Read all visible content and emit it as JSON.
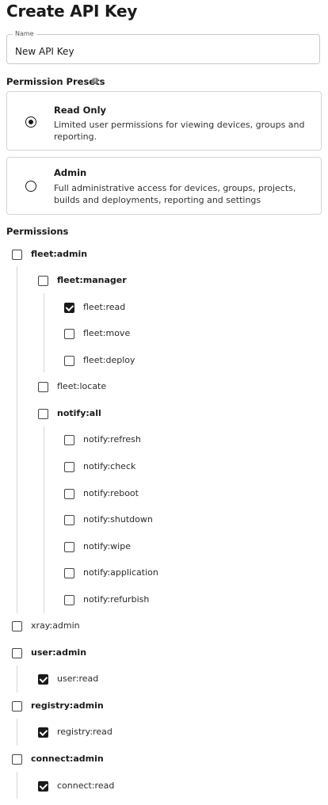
{
  "page": {
    "title": "Create API Key"
  },
  "name_field": {
    "label": "Name",
    "value": "New API Key"
  },
  "presets": {
    "heading": "Permission Presets",
    "info_icon": "info-icon",
    "items": [
      {
        "title": "Read Only",
        "description": "Limited user permissions for viewing devices, groups and reporting.",
        "selected": true
      },
      {
        "title": "Admin",
        "description": "Full administrative access for devices, groups, projects, builds and deployments, reporting and settings",
        "selected": false
      }
    ]
  },
  "permissions": {
    "heading": "Permissions",
    "items": [
      {
        "label": "fleet:admin",
        "checked": false,
        "level": 0,
        "bold": true
      },
      {
        "label": "fleet:manager",
        "checked": false,
        "level": 1,
        "bold": true
      },
      {
        "label": "fleet:read",
        "checked": true,
        "level": 2,
        "bold": false
      },
      {
        "label": "fleet:move",
        "checked": false,
        "level": 2,
        "bold": false
      },
      {
        "label": "fleet:deploy",
        "checked": false,
        "level": 2,
        "bold": false
      },
      {
        "label": "fleet:locate",
        "checked": false,
        "level": 1,
        "bold": false
      },
      {
        "label": "notify:all",
        "checked": false,
        "level": 1,
        "bold": true
      },
      {
        "label": "notify:refresh",
        "checked": false,
        "level": 2,
        "bold": false
      },
      {
        "label": "notify:check",
        "checked": false,
        "level": 2,
        "bold": false
      },
      {
        "label": "notify:reboot",
        "checked": false,
        "level": 2,
        "bold": false
      },
      {
        "label": "notify:shutdown",
        "checked": false,
        "level": 2,
        "bold": false
      },
      {
        "label": "notify:wipe",
        "checked": false,
        "level": 2,
        "bold": false
      },
      {
        "label": "notify:application",
        "checked": false,
        "level": 2,
        "bold": false
      },
      {
        "label": "notify:refurbish",
        "checked": false,
        "level": 2,
        "bold": false
      },
      {
        "label": "xray:admin",
        "checked": false,
        "level": 0,
        "bold": false
      },
      {
        "label": "user:admin",
        "checked": false,
        "level": 0,
        "bold": true
      },
      {
        "label": "user:read",
        "checked": true,
        "level": 1,
        "bold": false
      },
      {
        "label": "registry:admin",
        "checked": false,
        "level": 0,
        "bold": true
      },
      {
        "label": "registry:read",
        "checked": true,
        "level": 1,
        "bold": false
      },
      {
        "label": "connect:admin",
        "checked": false,
        "level": 0,
        "bold": true
      },
      {
        "label": "connect:read",
        "checked": true,
        "level": 1,
        "bold": false
      }
    ]
  },
  "colors": {
    "accent": "#1a1a1a",
    "border": "#d4d4d4",
    "tree_line": "#d6d6d6"
  }
}
